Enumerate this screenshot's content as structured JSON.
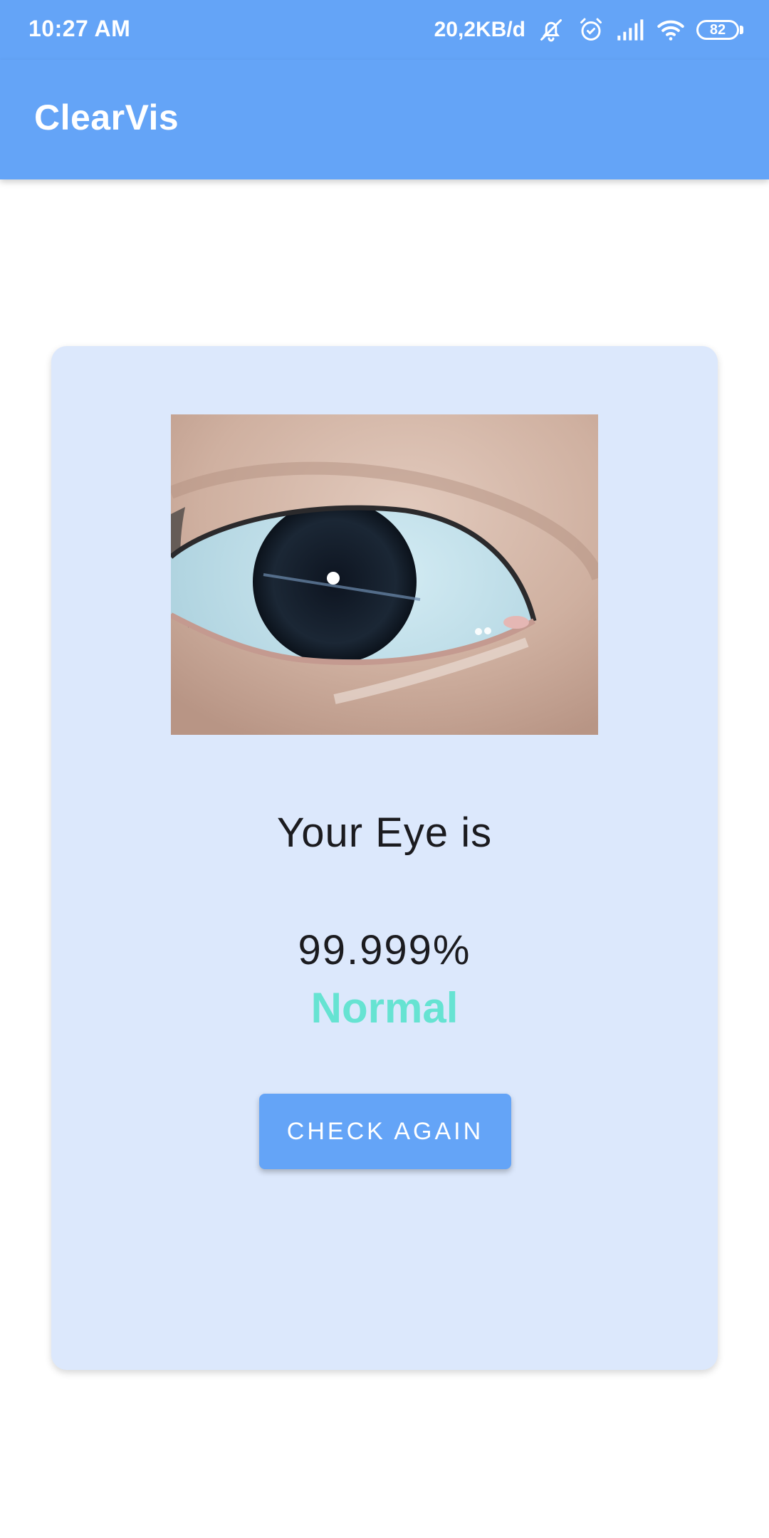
{
  "status_bar": {
    "time": "10:27 AM",
    "net_speed": "20,2KB/d",
    "battery_level": "82",
    "icons": [
      "bell-off-icon",
      "alarm-icon",
      "signal-icon",
      "wifi-icon",
      "battery-icon"
    ]
  },
  "app_bar": {
    "title": "ClearVis",
    "color": "#64a4f7"
  },
  "result_card": {
    "background": "#dce8fc",
    "heading": "Your Eye is",
    "percent": "99.999%",
    "label": "Normal",
    "label_color": "#66e3d2",
    "button_label": "CHECK AGAIN"
  }
}
